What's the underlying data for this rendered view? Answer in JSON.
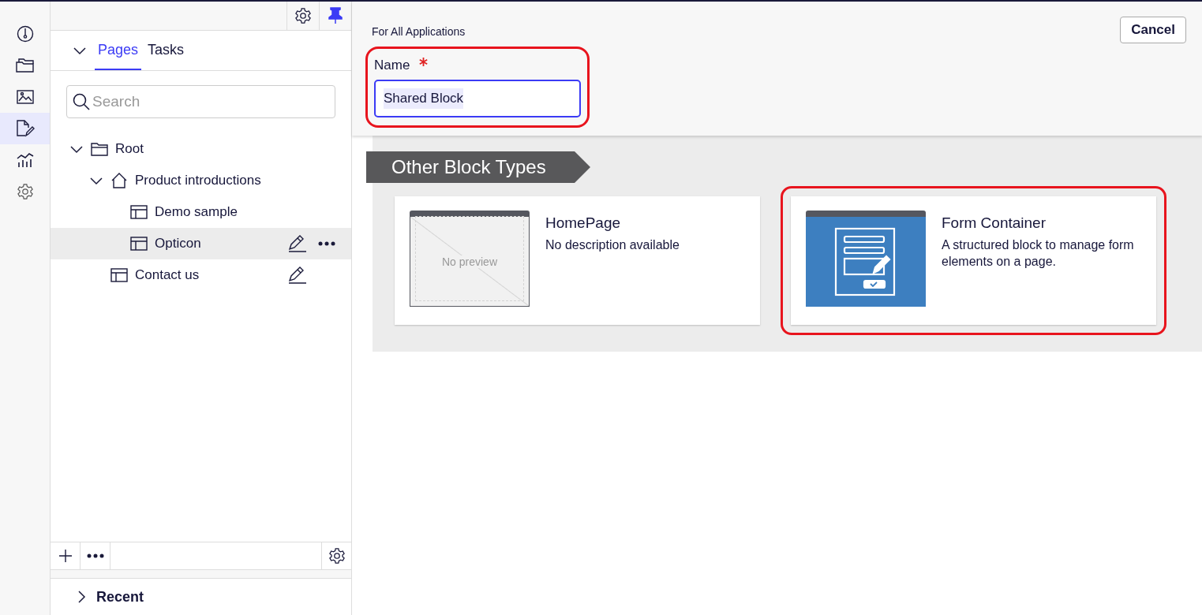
{
  "rail": [
    {
      "kind": "dashboard",
      "selected": false
    },
    {
      "kind": "folders",
      "selected": false
    },
    {
      "kind": "media",
      "selected": false
    },
    {
      "kind": "edit",
      "selected": true
    },
    {
      "kind": "reports",
      "selected": false
    },
    {
      "kind": "settings",
      "selected": false
    }
  ],
  "panel": {
    "pinned": true,
    "tabs": [
      {
        "label": "Pages",
        "selected": true
      },
      {
        "label": "Tasks",
        "selected": false
      }
    ],
    "search": {
      "placeholder": "Search"
    },
    "tree": [
      {
        "label": "Root",
        "kind": "folder",
        "expanded": true,
        "selected": false,
        "children": [
          {
            "label": "Product introductions",
            "kind": "home",
            "expanded": true,
            "selected": false,
            "children": [
              {
                "label": "Demo sample",
                "kind": "page",
                "selected": false
              },
              {
                "label": "Opticon",
                "kind": "page",
                "selected": true,
                "editable": true
              }
            ]
          },
          {
            "label": "Contact us",
            "kind": "page",
            "selected": false,
            "editable": true
          }
        ]
      }
    ],
    "recent": {
      "label": "Recent",
      "expanded": false
    }
  },
  "header": {
    "scope": "For All Applications",
    "cancel": "Cancel",
    "name_label": "Name",
    "required": true,
    "name_value": "Shared Block",
    "highlighted": true
  },
  "section": {
    "title": "Other Block Types",
    "blocks": [
      {
        "kind": "no-preview",
        "preview_text": "No preview",
        "title": "HomePage",
        "description": "No description available",
        "highlighted": false
      },
      {
        "kind": "form",
        "title": "Form Container",
        "description": "A structured block to manage form elements on a page.",
        "highlighted": true
      }
    ]
  }
}
